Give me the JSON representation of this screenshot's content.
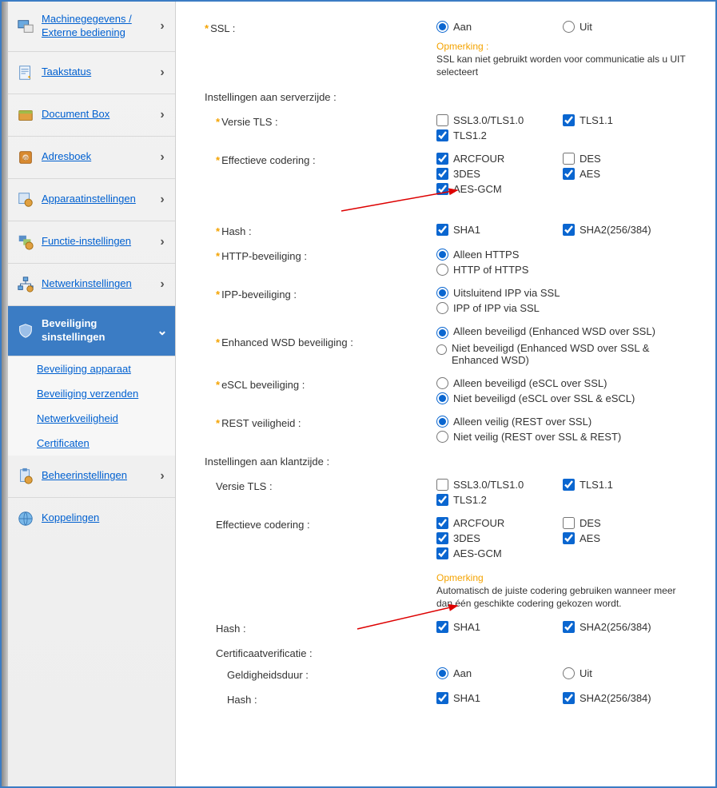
{
  "sidebar": {
    "items": [
      {
        "label": "Machinegegevens / Externe bediening"
      },
      {
        "label": "Taakstatus"
      },
      {
        "label": "Document Box"
      },
      {
        "label": "Adresboek"
      },
      {
        "label": "Apparaatinstellingen"
      },
      {
        "label": "Functie-instellingen"
      },
      {
        "label": "Netwerkinstellingen"
      },
      {
        "label": "Beveiliging sinstellingen"
      },
      {
        "label": "Beheerinstellingen"
      },
      {
        "label": "Koppelingen"
      }
    ],
    "sub": [
      {
        "label": "Beveiliging apparaat"
      },
      {
        "label": "Beveiliging verzenden"
      },
      {
        "label": "Netwerkveiligheid"
      },
      {
        "label": "Certificaten"
      }
    ]
  },
  "labels": {
    "ssl": "SSL :",
    "server_header": "Instellingen aan serverzijde :",
    "versie_tls": "Versie TLS :",
    "enc": "Effectieve codering :",
    "hash": "Hash :",
    "http": "HTTP-beveiliging :",
    "ipp": "IPP-beveiliging :",
    "ewsd": "Enhanced WSD beveiliging :",
    "escl": "eSCL beveiliging :",
    "rest": "REST veiligheid :",
    "client_header": "Instellingen aan klantzijde :",
    "cert": "Certificaatverificatie :",
    "geldig": "Geldigheidsduur :",
    "note_word": "Opmerking :",
    "note_word2": "Opmerking",
    "ssl_note": "SSL kan niet gebruikt worden voor communicatie als u UIT selecteert",
    "enc_note": "Automatisch de juiste codering gebruiken wanneer meer dan één geschikte codering gekozen wordt."
  },
  "opts": {
    "aan": "Aan",
    "uit": "Uit",
    "ssl30": "SSL3.0/TLS1.0",
    "tls11": "TLS1.1",
    "tls12": "TLS1.2",
    "arcfour": "ARCFOUR",
    "des": "DES",
    "tdes": "3DES",
    "aes": "AES",
    "aesgcm": "AES-GCM",
    "sha1": "SHA1",
    "sha2": "SHA2(256/384)",
    "http1": "Alleen HTTPS",
    "http2": "HTTP of HTTPS",
    "ipp1": "Uitsluitend IPP via SSL",
    "ipp2": "IPP of IPP via SSL",
    "ewsd1": "Alleen beveiligd (Enhanced WSD over SSL)",
    "ewsd2": "Niet beveiligd (Enhanced WSD over SSL & Enhanced WSD)",
    "escl1": "Alleen beveiligd (eSCL over SSL)",
    "escl2": "Niet beveiligd (eSCL over SSL & eSCL)",
    "rest1": "Alleen veilig (REST over SSL)",
    "rest2": "Niet veilig (REST over SSL & REST)"
  }
}
